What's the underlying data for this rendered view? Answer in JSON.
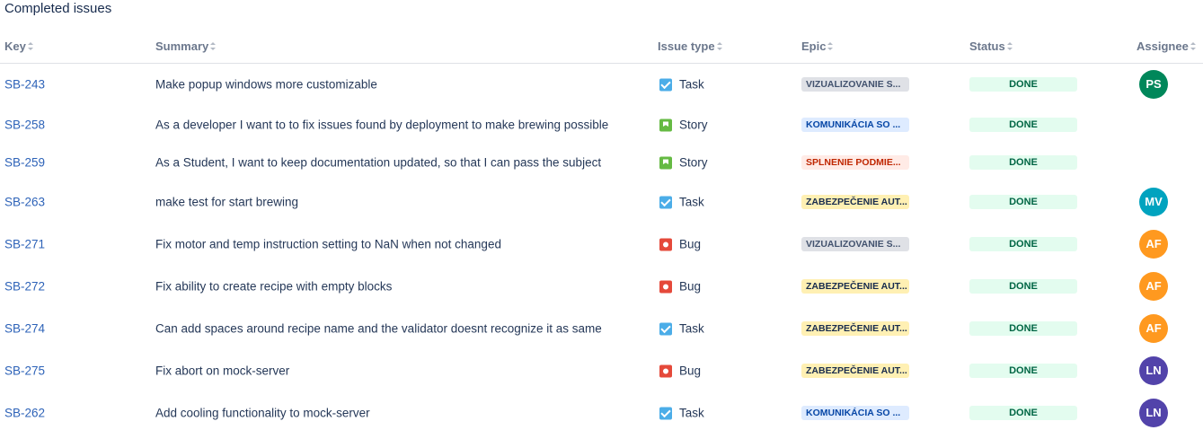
{
  "section_title": "Completed issues",
  "columns": {
    "key": "Key",
    "summary": "Summary",
    "issue_type": "Issue type",
    "epic": "Epic",
    "status": "Status",
    "assignee": "Assignee"
  },
  "colors": {
    "link": "#2e63b8",
    "done_bg": "#e3fcef",
    "done_text": "#006644",
    "epic_grey_bg": "#dfe1e6",
    "epic_blue_bg": "#deebff",
    "epic_red_bg": "#ffebe6",
    "epic_yellow_bg": "#fff0b3"
  },
  "rows": [
    {
      "key": "SB-243",
      "summary": "Make popup windows more customizable",
      "type": "Task",
      "type_icon": "task-icon",
      "epic": "VIZUALIZOVANIE S...",
      "epic_color": "grey",
      "status": "DONE",
      "assignee": "PS",
      "avatar_color": "#00875a"
    },
    {
      "key": "SB-258",
      "summary": "As a developer I want to to fix issues found by deployment to make brewing possible",
      "type": "Story",
      "type_icon": "story-icon",
      "epic": "KOMUNIKÁCIA SO ...",
      "epic_color": "blue",
      "status": "DONE",
      "assignee": "",
      "avatar_color": ""
    },
    {
      "key": "SB-259",
      "summary": "As a Student, I want to keep documentation updated, so that I can pass the subject",
      "type": "Story",
      "type_icon": "story-icon",
      "epic": "SPLNENIE PODMIE...",
      "epic_color": "red",
      "status": "DONE",
      "assignee": "",
      "avatar_color": ""
    },
    {
      "key": "SB-263",
      "summary": "make test for start brewing",
      "type": "Task",
      "type_icon": "task-icon",
      "epic": "ZABEZPEČENIE AUT...",
      "epic_color": "yellow",
      "status": "DONE",
      "assignee": "MV",
      "avatar_color": "#00a3bf"
    },
    {
      "key": "SB-271",
      "summary": "Fix motor and temp instruction setting to NaN when not changed",
      "type": "Bug",
      "type_icon": "bug-icon",
      "epic": "VIZUALIZOVANIE S...",
      "epic_color": "grey",
      "status": "DONE",
      "assignee": "AF",
      "avatar_color": "#ff991f"
    },
    {
      "key": "SB-272",
      "summary": "Fix ability to create recipe with empty blocks",
      "type": "Bug",
      "type_icon": "bug-icon",
      "epic": "ZABEZPEČENIE AUT...",
      "epic_color": "yellow",
      "status": "DONE",
      "assignee": "AF",
      "avatar_color": "#ff991f"
    },
    {
      "key": "SB-274",
      "summary": "Can add spaces around recipe name and the validator doesnt recognize it as same",
      "type": "Task",
      "type_icon": "task-icon",
      "epic": "ZABEZPEČENIE AUT...",
      "epic_color": "yellow",
      "status": "DONE",
      "assignee": "AF",
      "avatar_color": "#ff991f"
    },
    {
      "key": "SB-275",
      "summary": "Fix abort on mock-server",
      "type": "Bug",
      "type_icon": "bug-icon",
      "epic": "ZABEZPEČENIE AUT...",
      "epic_color": "yellow",
      "status": "DONE",
      "assignee": "LN",
      "avatar_color": "#5243aa"
    },
    {
      "key": "SB-262",
      "summary": "Add cooling functionality to mock-server",
      "type": "Task",
      "type_icon": "task-icon",
      "epic": "KOMUNIKÁCIA SO ...",
      "epic_color": "blue",
      "status": "DONE",
      "assignee": "LN",
      "avatar_color": "#5243aa"
    }
  ]
}
